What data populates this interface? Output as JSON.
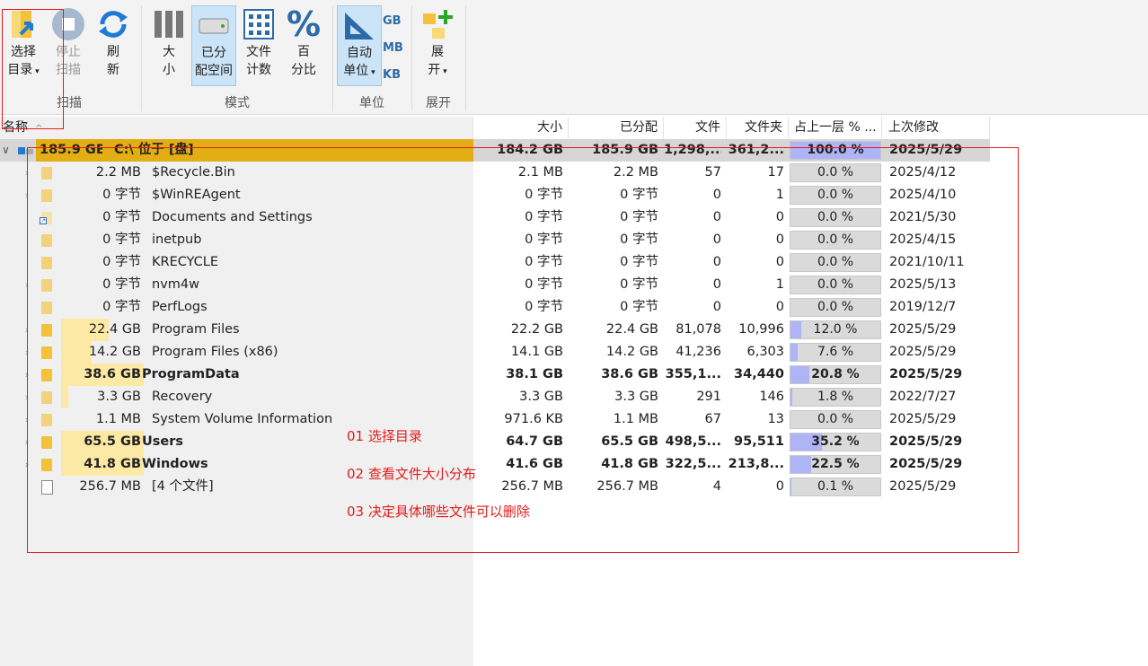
{
  "ribbon": {
    "buttons": [
      {
        "key": "select",
        "line1": "选择",
        "line2": "目录",
        "dropdown": true,
        "state": "normal"
      },
      {
        "key": "stop",
        "line1": "停止",
        "line2": "扫描",
        "state": "disabled"
      },
      {
        "key": "refresh",
        "line1": "刷",
        "line2": "新",
        "state": "normal"
      },
      {
        "key": "size",
        "line1": "大",
        "line2": "小",
        "state": "normal"
      },
      {
        "key": "allocated",
        "line1": "已分",
        "line2": "配空间",
        "state": "selected"
      },
      {
        "key": "filecount",
        "line1": "文件",
        "line2": "计数",
        "state": "normal"
      },
      {
        "key": "percent",
        "line1": "百",
        "line2": "分比",
        "state": "normal"
      },
      {
        "key": "autounit",
        "line1": "自动",
        "line2": "单位",
        "dropdown": true,
        "state": "selected"
      },
      {
        "key": "expand",
        "line1": "展",
        "line2": "开",
        "dropdown": true,
        "state": "normal"
      }
    ],
    "units": [
      "GB",
      "MB",
      "KB"
    ],
    "groups": [
      "扫描",
      "模式",
      "单位",
      "展开"
    ]
  },
  "columns": [
    "名称",
    "大小",
    "已分配",
    "文件",
    "文件夹",
    "占上一层 % ...",
    "上次修改"
  ],
  "root": {
    "size_label": "185.9 GB",
    "name": "C:\\  位于  [盘]",
    "size": "184.2 GB",
    "allocated": "185.9 GB",
    "files": "1,298,...",
    "folders": "361,2...",
    "pct_text": "100.0 %",
    "pct": 1.0,
    "modified": "2025/5/29"
  },
  "rows": [
    {
      "size_label": "2.2 MB",
      "name": "$Recycle.Bin",
      "size": "2.1 MB",
      "allocated": "2.2 MB",
      "files": "57",
      "folders": "17",
      "pct_text": "0.0 %",
      "pct": 0,
      "modified": "2025/4/12",
      "bar": 0,
      "bold": false,
      "chev": true,
      "type": "folder"
    },
    {
      "size_label": "0 字节",
      "name": "$WinREAgent",
      "size": "0 字节",
      "allocated": "0 字节",
      "files": "0",
      "folders": "1",
      "pct_text": "0.0 %",
      "pct": 0,
      "modified": "2025/4/10",
      "bar": 0,
      "bold": false,
      "chev": true,
      "type": "folder"
    },
    {
      "size_label": "0 字节",
      "name": "Documents and Settings",
      "size": "0 字节",
      "allocated": "0 字节",
      "files": "0",
      "folders": "0",
      "pct_text": "0.0 %",
      "pct": 0,
      "modified": "2021/5/30",
      "bar": 0,
      "bold": false,
      "chev": false,
      "type": "link"
    },
    {
      "size_label": "0 字节",
      "name": "inetpub",
      "size": "0 字节",
      "allocated": "0 字节",
      "files": "0",
      "folders": "0",
      "pct_text": "0.0 %",
      "pct": 0,
      "modified": "2025/4/15",
      "bar": 0,
      "bold": false,
      "chev": false,
      "type": "folder"
    },
    {
      "size_label": "0 字节",
      "name": "KRECYCLE",
      "size": "0 字节",
      "allocated": "0 字节",
      "files": "0",
      "folders": "0",
      "pct_text": "0.0 %",
      "pct": 0,
      "modified": "2021/10/11",
      "bar": 0,
      "bold": false,
      "chev": false,
      "type": "folder"
    },
    {
      "size_label": "0 字节",
      "name": "nvm4w",
      "size": "0 字节",
      "allocated": "0 字节",
      "files": "0",
      "folders": "1",
      "pct_text": "0.0 %",
      "pct": 0,
      "modified": "2025/5/13",
      "bar": 0,
      "bold": false,
      "chev": true,
      "type": "folder"
    },
    {
      "size_label": "0 字节",
      "name": "PerfLogs",
      "size": "0 字节",
      "allocated": "0 字节",
      "files": "0",
      "folders": "0",
      "pct_text": "0.0 %",
      "pct": 0,
      "modified": "2019/12/7",
      "bar": 0,
      "bold": false,
      "chev": false,
      "type": "folder"
    },
    {
      "size_label": "22.4 GB",
      "name": "Program Files",
      "size": "22.2 GB",
      "allocated": "22.4 GB",
      "files": "81,078",
      "folders": "10,996",
      "pct_text": "12.0 %",
      "pct": 0.12,
      "modified": "2025/5/29",
      "bar": 0.58,
      "bold": false,
      "chev": true,
      "type": "folder"
    },
    {
      "size_label": "14.2 GB",
      "name": "Program Files (x86)",
      "size": "14.1 GB",
      "allocated": "14.2 GB",
      "files": "41,236",
      "folders": "6,303",
      "pct_text": "7.6 %",
      "pct": 0.076,
      "modified": "2025/5/29",
      "bar": 0.37,
      "bold": false,
      "chev": true,
      "type": "folder"
    },
    {
      "size_label": "38.6 GB",
      "name": "ProgramData",
      "size": "38.1 GB",
      "allocated": "38.6 GB",
      "files": "355,1...",
      "folders": "34,440",
      "pct_text": "20.8 %",
      "pct": 0.208,
      "modified": "2025/5/29",
      "bar": 1.0,
      "bold": true,
      "chev": true,
      "type": "folder"
    },
    {
      "size_label": "3.3 GB",
      "name": "Recovery",
      "size": "3.3 GB",
      "allocated": "3.3 GB",
      "files": "291",
      "folders": "146",
      "pct_text": "1.8 %",
      "pct": 0.018,
      "modified": "2022/7/27",
      "bar": 0.09,
      "bold": false,
      "chev": true,
      "type": "folder"
    },
    {
      "size_label": "1.1 MB",
      "name": "System Volume Information",
      "size": "971.6 KB",
      "allocated": "1.1 MB",
      "files": "67",
      "folders": "13",
      "pct_text": "0.0 %",
      "pct": 0,
      "modified": "2025/5/29",
      "bar": 0,
      "bold": false,
      "chev": true,
      "type": "folder"
    },
    {
      "size_label": "65.5 GB",
      "name": "Users",
      "size": "64.7 GB",
      "allocated": "65.5 GB",
      "files": "498,5...",
      "folders": "95,511",
      "pct_text": "35.2 %",
      "pct": 0.352,
      "modified": "2025/5/29",
      "bar": 1.0,
      "bold": true,
      "chev": true,
      "type": "folder"
    },
    {
      "size_label": "41.8 GB",
      "name": "Windows",
      "size": "41.6 GB",
      "allocated": "41.8 GB",
      "files": "322,5...",
      "folders": "213,8...",
      "pct_text": "22.5 %",
      "pct": 0.225,
      "modified": "2025/5/29",
      "bar": 1.0,
      "bold": true,
      "chev": true,
      "type": "folder"
    },
    {
      "size_label": "256.7 MB",
      "name": "[4 个文件]",
      "size": "256.7 MB",
      "allocated": "256.7 MB",
      "files": "4",
      "folders": "0",
      "pct_text": "0.1 %",
      "pct": 0.001,
      "modified": "2025/5/29",
      "bar": 0,
      "bold": false,
      "chev": false,
      "type": "file"
    }
  ],
  "annotations": [
    "01 选择目录",
    "02 查看文件大小分布",
    "03 决定具体哪些文件可以删除"
  ],
  "colors": {
    "accent": "#2d6aa8",
    "annotation": "#e21b1b",
    "bar": "#fde9a6",
    "pct_fill": "#aeb4f5",
    "selected_bg": "#cce4f7"
  }
}
